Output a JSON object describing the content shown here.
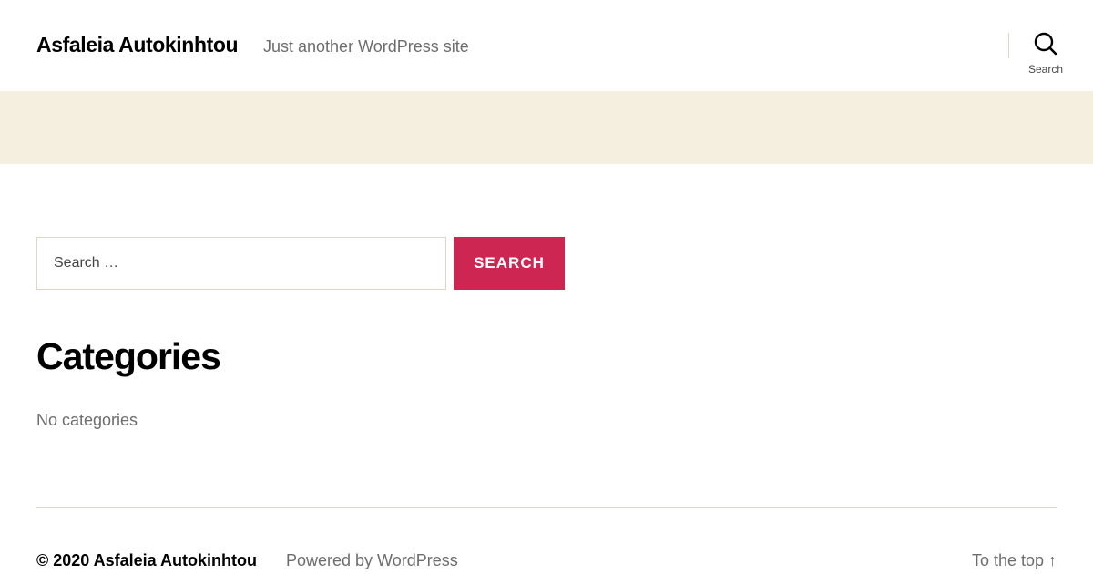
{
  "header": {
    "site_title": "Asfaleia Autokinhtou",
    "tagline": "Just another WordPress site",
    "search_toggle": {
      "icon": "search-icon",
      "label": "Search"
    }
  },
  "search_form": {
    "placeholder": "Search …",
    "value": "",
    "submit_label": "Search"
  },
  "widget": {
    "title": "Categories",
    "empty_text": "No categories"
  },
  "footer": {
    "copyright_prefix": "© 2020 ",
    "copyright_site": "Asfaleia Autokinhtou",
    "powered_by": "Powered by WordPress",
    "to_top": "To the top ↑"
  },
  "colors": {
    "accent": "#cd2653",
    "band": "#f5efe0",
    "muted_text": "#6d6d6d",
    "border": "#dcd7ca"
  }
}
